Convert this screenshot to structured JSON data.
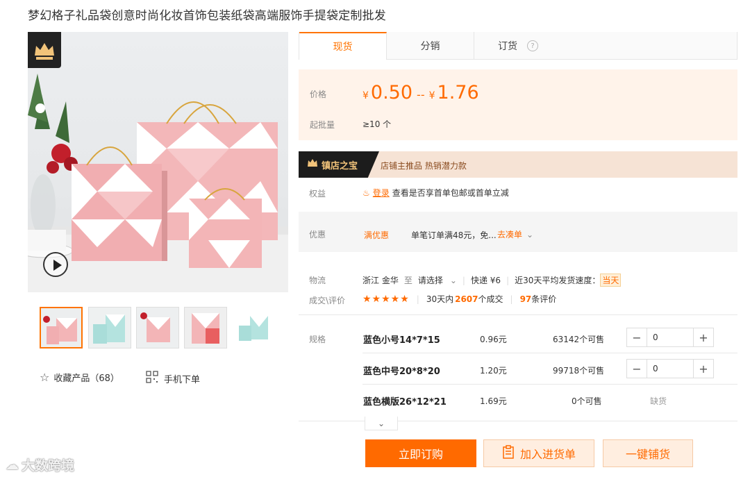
{
  "product": {
    "title": "梦幻格子礼品袋创意时尚化妆首饰包装纸袋高端服饰手提袋定制批发"
  },
  "tabs": [
    {
      "label": "现货"
    },
    {
      "label": "分销"
    },
    {
      "label": "订货"
    }
  ],
  "price": {
    "label": "价格",
    "currency": "¥",
    "low": "0.50",
    "sep": "--",
    "high": "1.76",
    "moq_label": "起批量",
    "moq_value": "≥10 个"
  },
  "treasure": {
    "badge": "镇店之宝",
    "text": "店铺主推品  热销潜力款"
  },
  "benefits": {
    "label": "权益",
    "login_link": "登录",
    "text": "查看是否享首单包邮或首单立减"
  },
  "promo": {
    "label": "优惠",
    "tag": "满优惠",
    "text": "单笔订单满48元，免...",
    "link": "去凑单"
  },
  "logistics": {
    "label": "物流",
    "origin": "浙江 金华",
    "to": "至",
    "dest": "请选择",
    "express": "快递 ¥6",
    "speed_label": "近30天平均发货速度：",
    "speed_value": "当天"
  },
  "deals": {
    "label": "成交\\评价",
    "stars": "★★★★★",
    "prefix": "30天内",
    "count": "2607",
    "suffix": "个成交",
    "reviews": "97",
    "reviews_suffix": "条评价"
  },
  "sku": {
    "label": "规格",
    "items": [
      {
        "name": "蓝色小号14*7*15",
        "price": "0.96元",
        "stock": "63142个可售",
        "qty": "0",
        "minus": "−",
        "plus": "+"
      },
      {
        "name": "蓝色中号20*8*20",
        "price": "1.20元",
        "stock": "99718个可售",
        "qty": "0",
        "minus": "−",
        "plus": "+"
      },
      {
        "name": "蓝色横版26*12*21",
        "price": "1.69元",
        "stock": "0个可售",
        "status": "缺货"
      }
    ]
  },
  "actions": {
    "order": "立即订购",
    "cart": "加入进货单",
    "distribute": "一键铺货"
  },
  "left": {
    "favorite": "收藏产品（68）",
    "mobile": "手机下单"
  },
  "watermark": "大数跨境",
  "colors": {
    "accent": "#ff6a00",
    "price_bg": "#fff3ea",
    "treasure_bg": "#f6e3d5"
  }
}
